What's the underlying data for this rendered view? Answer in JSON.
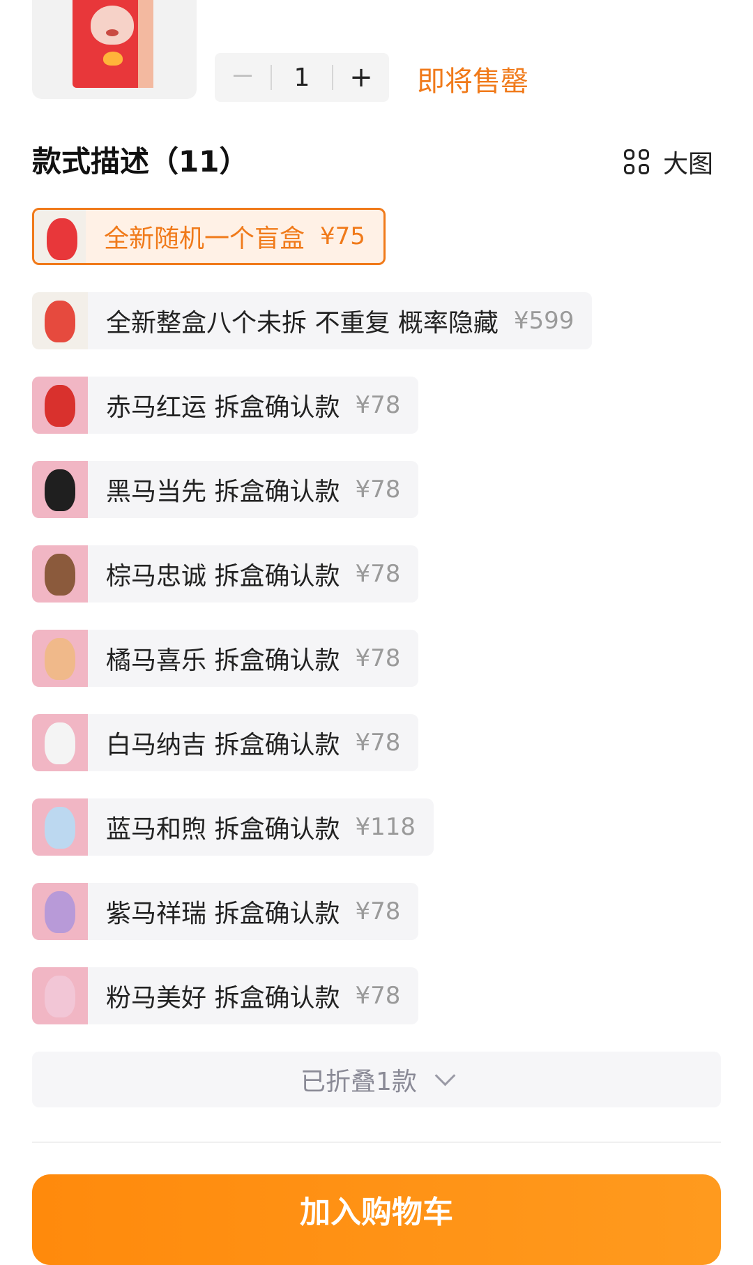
{
  "header": {
    "stepper": {
      "minus_label": "－",
      "quantity": "1",
      "plus_label": "+"
    },
    "stock_status": "即将售罄"
  },
  "section": {
    "title": "款式描述（11）",
    "view_toggle_label": "大图"
  },
  "options": [
    {
      "name": "全新随机一个盲盒",
      "price": "¥75",
      "selected": true,
      "thumb_color": "#e8373a"
    },
    {
      "name": "全新整盒八个未拆 不重复 概率隐藏",
      "price": "¥599",
      "selected": false,
      "thumb_color": "#e64a3e"
    },
    {
      "name": "赤马红运 拆盒确认款",
      "price": "¥78",
      "selected": false,
      "thumb_color": "#d9312d"
    },
    {
      "name": "黑马当先 拆盒确认款",
      "price": "¥78",
      "selected": false,
      "thumb_color": "#1f1f1f"
    },
    {
      "name": "棕马忠诚 拆盒确认款",
      "price": "¥78",
      "selected": false,
      "thumb_color": "#8b5a3c"
    },
    {
      "name": "橘马喜乐 拆盒确认款",
      "price": "¥78",
      "selected": false,
      "thumb_color": "#f0b98a"
    },
    {
      "name": "白马纳吉 拆盒确认款",
      "price": "¥78",
      "selected": false,
      "thumb_color": "#f4f4f4"
    },
    {
      "name": "蓝马和煦 拆盒确认款",
      "price": "¥118",
      "selected": false,
      "thumb_color": "#bcd8f0"
    },
    {
      "name": "紫马祥瑞 拆盒确认款",
      "price": "¥78",
      "selected": false,
      "thumb_color": "#b89ad8"
    },
    {
      "name": "粉马美好 拆盒确认款",
      "price": "¥78",
      "selected": false,
      "thumb_color": "#f2c6d6"
    }
  ],
  "collapsed": {
    "label": "已折叠1款"
  },
  "cart_button": {
    "label": "加入购物车"
  },
  "colors": {
    "accent": "#f07a1a",
    "thumb_bg": "#f1b6c4"
  }
}
